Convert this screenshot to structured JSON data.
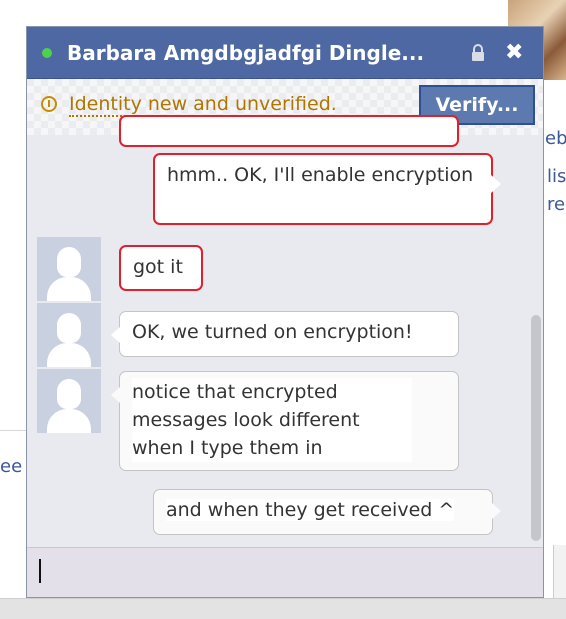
{
  "background": {
    "fragments": [
      {
        "id": "eb",
        "text": "eb"
      },
      {
        "id": "lis",
        "text": "lis"
      },
      {
        "id": "re",
        "text": "re"
      },
      {
        "id": "ee",
        "text": "ee"
      }
    ]
  },
  "chat": {
    "contact_name": "Barbara Amgdbgjadfgi Dingle...",
    "online": true,
    "icons": {
      "lock": "lock-icon",
      "close": "close-icon",
      "warning": "warning-icon"
    },
    "close_glyph": "✖",
    "identity_text": "Identity new and unverified.",
    "verify_label": "Verify...",
    "messages": [
      {
        "from": "me",
        "text": "hmm.. OK, I'll enable encryption",
        "style": "red"
      },
      {
        "from": "them",
        "text": "got it",
        "style": "red"
      },
      {
        "from": "them",
        "text": "OK, we turned on encryption!",
        "style": "gray"
      },
      {
        "from": "them",
        "text": "notice that encrypted messages look different when I type them in",
        "style": "gray-pattern"
      },
      {
        "from": "me",
        "text": "and when they get received ^",
        "style": "gray-pattern"
      }
    ],
    "input_value": ""
  },
  "colors": {
    "header_bg": "#4d68a2",
    "online_dot": "#4ed14e",
    "warning": "#b07600",
    "unencrypted_border": "#e0202a"
  }
}
